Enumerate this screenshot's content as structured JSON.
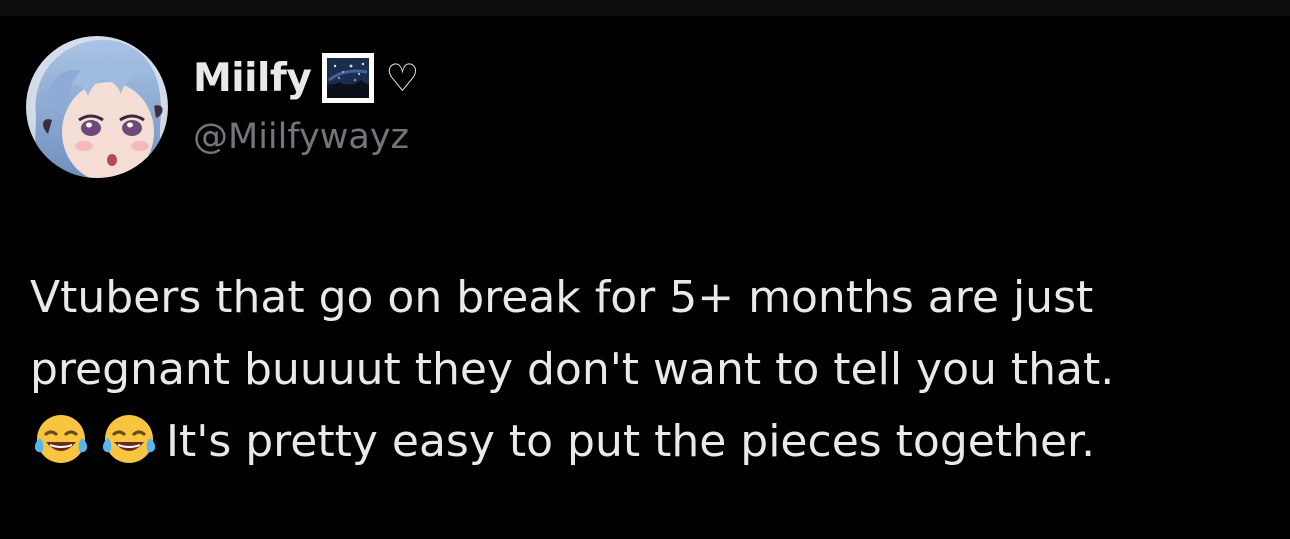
{
  "tweet": {
    "author": {
      "display_name": "Miilfy",
      "name_badge": "night-sky-icon",
      "name_suffix": "♡",
      "handle": "@Miilfywayz",
      "avatar": "anime-avatar"
    },
    "text_lines": [
      "Vtubers that go on break for 5+ months are just",
      "pregnant buuuut they don't want to tell you that.",
      "It's pretty easy to put the pieces together."
    ],
    "line3_prefix_emojis": [
      "tears-of-joy-icon",
      "tears-of-joy-icon"
    ]
  },
  "colors": {
    "background": "#000000",
    "text": "#e7e9ea",
    "secondary_text": "#71767b"
  }
}
